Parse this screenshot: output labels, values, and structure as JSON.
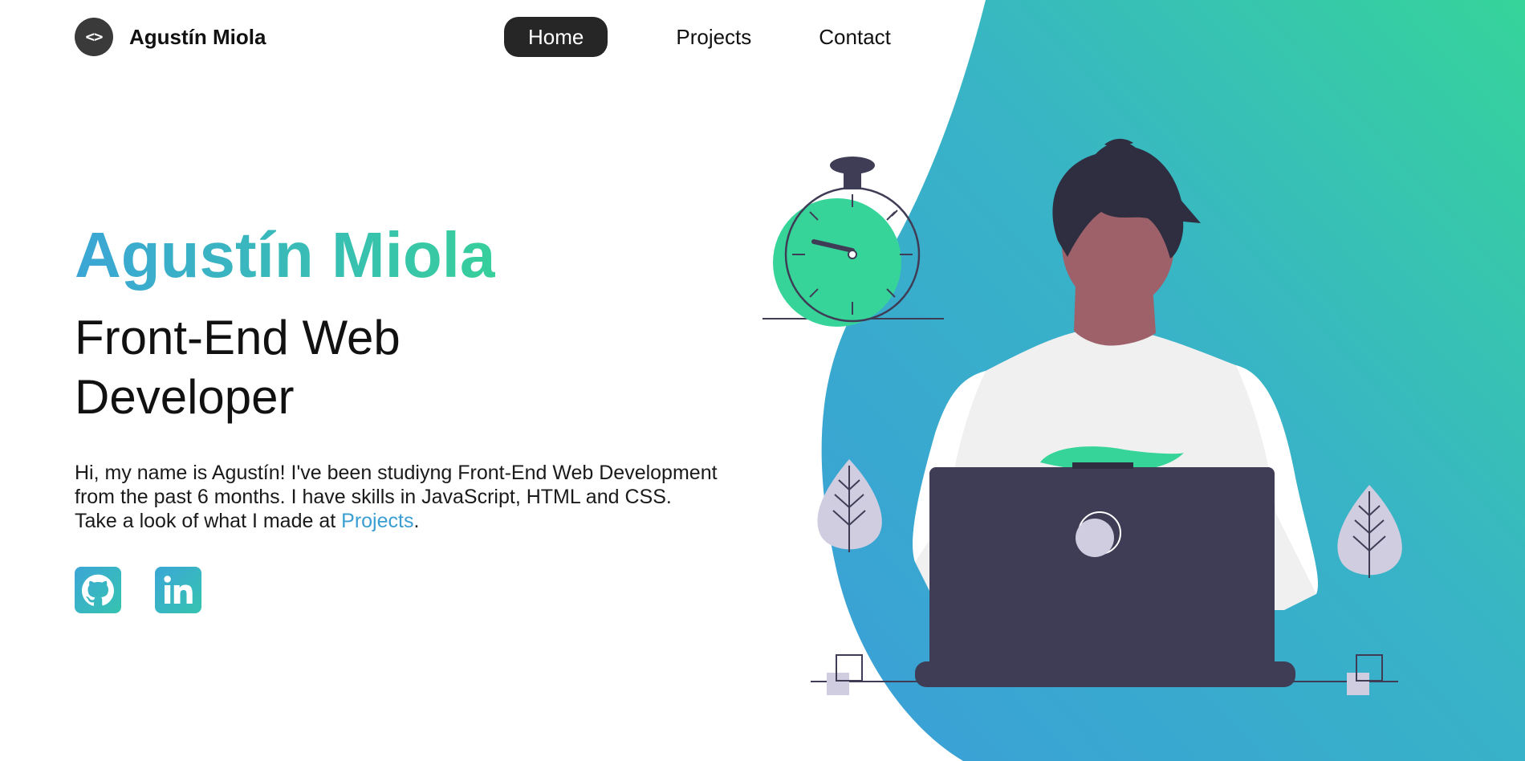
{
  "header": {
    "brand_logo_text": "<>",
    "brand_name": "Agustín Miola",
    "nav": [
      {
        "label": "Home",
        "active": true
      },
      {
        "label": "Projects",
        "active": false
      },
      {
        "label": "Contact",
        "active": false
      }
    ]
  },
  "hero": {
    "name": "Agustín Miola",
    "role": "Front-End Web Developer",
    "description_line1": "Hi, my name is Agustín! I've been studiyng Front-End Web Development from the past 6 months. I have skills in JavaScript, HTML and CSS.",
    "description_line2_prefix": "Take a look of what I made at ",
    "description_link": "Projects",
    "description_line2_suffix": "."
  },
  "socials": [
    {
      "name": "github",
      "icon": "github-icon"
    },
    {
      "name": "linkedin",
      "icon": "linkedin-icon"
    }
  ],
  "colors": {
    "gradient_start": "#3ba6d6",
    "gradient_end": "#37cf9c",
    "dark": "#262626",
    "laptop": "#3f3d56",
    "link": "#3a9ed2"
  }
}
